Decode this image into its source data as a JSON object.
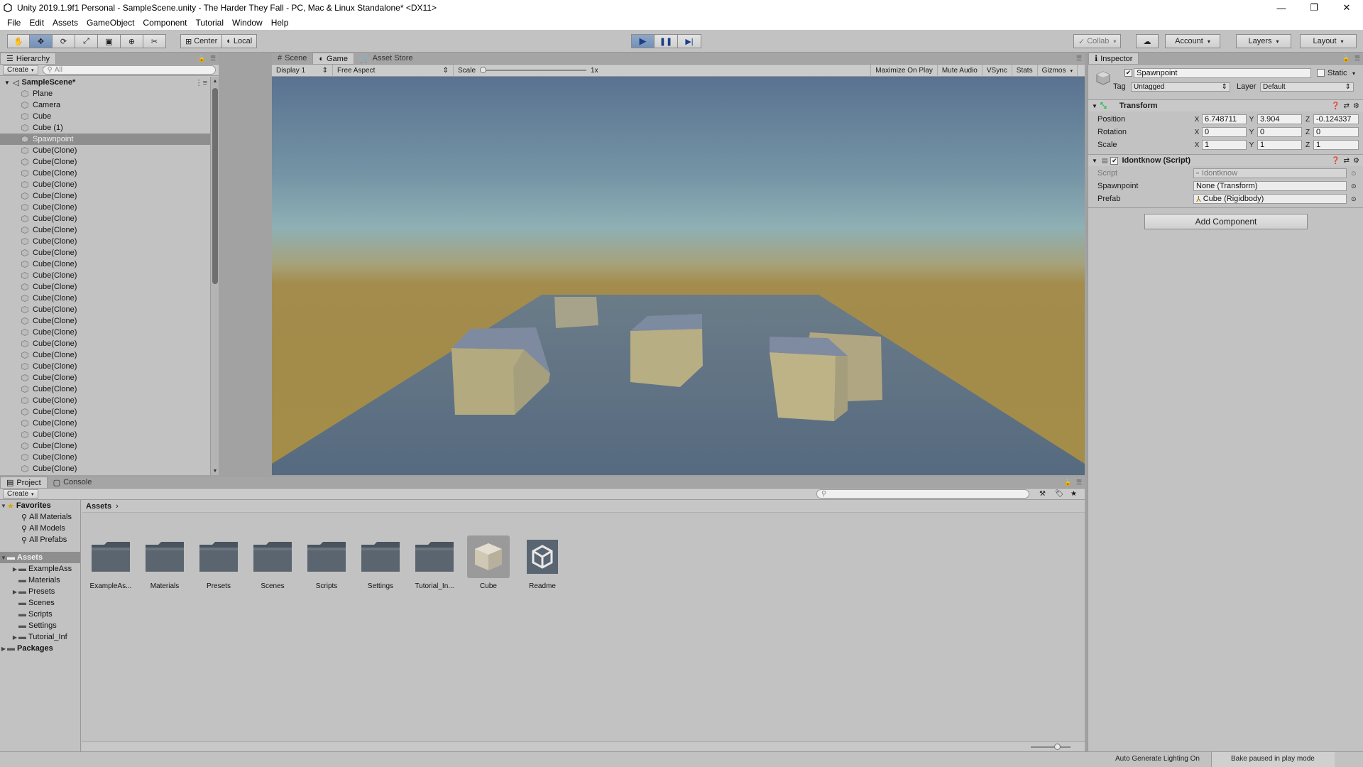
{
  "window": {
    "title": "Unity 2019.1.9f1 Personal - SampleScene.unity - The Harder They Fall - PC, Mac & Linux Standalone* <DX11>"
  },
  "menu": [
    "File",
    "Edit",
    "Assets",
    "GameObject",
    "Component",
    "Tutorial",
    "Window",
    "Help"
  ],
  "toolbar": {
    "pivot_label": "Center",
    "space_label": "Local",
    "collab_label": "Collab",
    "account_label": "Account",
    "layers_label": "Layers",
    "layout_label": "Layout"
  },
  "hierarchy": {
    "tab": "Hierarchy",
    "create_label": "Create",
    "search_placeholder": "All",
    "scene_name": "SampleScene*",
    "items": [
      "Plane",
      "Camera",
      "Cube",
      "Cube (1)",
      "Spawnpoint",
      "Cube(Clone)",
      "Cube(Clone)",
      "Cube(Clone)",
      "Cube(Clone)",
      "Cube(Clone)",
      "Cube(Clone)",
      "Cube(Clone)",
      "Cube(Clone)",
      "Cube(Clone)",
      "Cube(Clone)",
      "Cube(Clone)",
      "Cube(Clone)",
      "Cube(Clone)",
      "Cube(Clone)",
      "Cube(Clone)",
      "Cube(Clone)",
      "Cube(Clone)",
      "Cube(Clone)",
      "Cube(Clone)",
      "Cube(Clone)",
      "Cube(Clone)",
      "Cube(Clone)",
      "Cube(Clone)",
      "Cube(Clone)",
      "Cube(Clone)",
      "Cube(Clone)",
      "Cube(Clone)",
      "Cube(Clone)",
      "Cube(Clone)",
      "Cube(Clone)"
    ],
    "selected": "Spawnpoint"
  },
  "game": {
    "tabs": [
      "Scene",
      "Game",
      "Asset Store"
    ],
    "active_tab": "Game",
    "display": "Display 1",
    "aspect": "Free Aspect",
    "scale_label": "Scale",
    "scale_value": "1x",
    "options": [
      "Maximize On Play",
      "Mute Audio",
      "VSync",
      "Stats",
      "Gizmos"
    ]
  },
  "inspector": {
    "tab": "Inspector",
    "object_name": "Spawnpoint",
    "static_label": "Static",
    "tag_label": "Tag",
    "tag_value": "Untagged",
    "layer_label": "Layer",
    "layer_value": "Default",
    "transform": {
      "title": "Transform",
      "position_label": "Position",
      "rotation_label": "Rotation",
      "scale_label": "Scale",
      "position": {
        "x": "6.748711",
        "y": "3.904",
        "z": "-0.124337"
      },
      "rotation": {
        "x": "0",
        "y": "0",
        "z": "0"
      },
      "scale": {
        "x": "1",
        "y": "1",
        "z": "1"
      }
    },
    "script_component": {
      "title": "Idontknow (Script)",
      "script_label": "Script",
      "script_value": "Idontknow",
      "spawnpoint_label": "Spawnpoint",
      "spawnpoint_value": "None (Transform)",
      "prefab_label": "Prefab",
      "prefab_value": "Cube (Rigidbody)"
    },
    "add_component_label": "Add Component"
  },
  "project": {
    "tabs": [
      "Project",
      "Console"
    ],
    "create_label": "Create",
    "favorites_label": "Favorites",
    "favorites": [
      "All Materials",
      "All Models",
      "All Prefabs"
    ],
    "assets_label": "Assets",
    "asset_folders": [
      "ExampleAss",
      "Materials",
      "Presets",
      "Scenes",
      "Scripts",
      "Settings",
      "Tutorial_Inf"
    ],
    "packages_label": "Packages",
    "breadcrumb": "Assets",
    "grid_items": [
      "ExampleAs...",
      "Materials",
      "Presets",
      "Scenes",
      "Scripts",
      "Settings",
      "Tutorial_In...",
      "Cube",
      "Readme"
    ]
  },
  "status": {
    "lighting": "Auto Generate Lighting On",
    "bake": "Bake paused in play mode"
  },
  "colors": {
    "play_active": "#7591bb",
    "sky_top": "#5b7491",
    "ground": "#9e8a4a",
    "plane": "#5f6f80",
    "cube": "#b5ab7f"
  }
}
